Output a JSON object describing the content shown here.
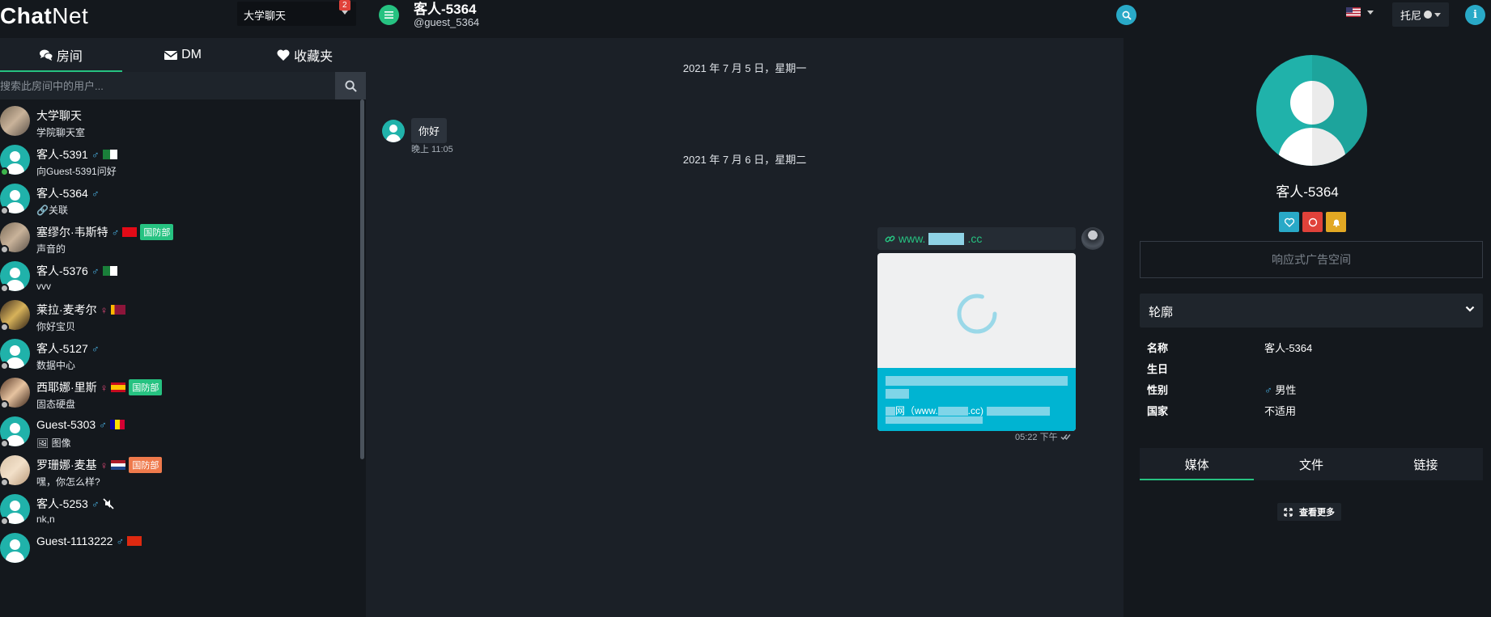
{
  "app": {
    "logo_bold": "Chat",
    "logo_light": "Net"
  },
  "room_select": {
    "value": "大学聊天",
    "badge": "2"
  },
  "sidebar_tabs": [
    {
      "label": "房间",
      "icon": "comments-icon",
      "active": true
    },
    {
      "label": "DM",
      "icon": "envelope-icon",
      "active": false
    },
    {
      "label": "收藏夹",
      "icon": "heart-icon",
      "active": false
    }
  ],
  "user_search": {
    "placeholder": "搜索此房间中的用户..."
  },
  "users": [
    {
      "name": "大学聊天",
      "message": "学院聊天室",
      "avatar": "photo",
      "status": "none"
    },
    {
      "name": "客人-5391",
      "gender": "♂",
      "flag": "algeria",
      "message": "向Guest-5391问好",
      "avatar": "default",
      "status": "online"
    },
    {
      "name": "客人-5364",
      "gender": "♂",
      "message": "🔗关联",
      "avatar": "default",
      "status": "away"
    },
    {
      "name": "塞缪尔·韦斯特",
      "gender": "♂",
      "flag": "turkey",
      "badge": "国防部",
      "badge_color": "#26c281",
      "message": "声音的",
      "avatar": "photo",
      "status": "away"
    },
    {
      "name": "客人-5376",
      "gender": "♂",
      "flag": "algeria",
      "message": "vvv",
      "avatar": "default",
      "status": "away"
    },
    {
      "name": "莱拉·麦考尔",
      "gender": "♀",
      "flag": "sri-lanka",
      "message": "你好宝贝",
      "avatar": "photo",
      "status": "away"
    },
    {
      "name": "客人-5127",
      "gender": "♂",
      "message": "数据中心",
      "avatar": "default",
      "status": "away"
    },
    {
      "name": "西耶娜·里斯",
      "gender": "♀",
      "flag": "spain",
      "badge": "国防部",
      "badge_color": "#26c281",
      "message": "固态硬盘",
      "avatar": "photo",
      "status": "away"
    },
    {
      "name": "Guest-5303",
      "gender": "♂",
      "flag": "andorra",
      "message": "🖼 图像",
      "avatar": "default",
      "status": "away"
    },
    {
      "name": "罗珊娜·麦基",
      "gender": "♀",
      "flag": "netherlands",
      "badge": "国防部",
      "badge_color": "#ef7a4c",
      "message": "嘿，你怎么样?",
      "avatar": "photo",
      "status": "away"
    },
    {
      "name": "客人-5253",
      "gender": "♂",
      "extra_icon": "muted-icon",
      "message": "nk,n",
      "avatar": "default",
      "status": "away"
    },
    {
      "name": "Guest-1113222",
      "gender": "♂",
      "flag": "china",
      "message": "",
      "avatar": "default",
      "status": "away"
    }
  ],
  "topbar": {
    "title": "客人-5364",
    "handle": "@guest_5364",
    "user_menu": "托尼",
    "lang_flag": "us"
  },
  "chat": {
    "date1": "2021 年 7 月 5 日，星期一",
    "msg1_text": "你好",
    "msg1_time": "晚上 11:05",
    "date2": "2021 年 7 月 6 日，星期二",
    "link_prefix": "www.",
    "link_suffix": ".cc",
    "link_desc": "网（www.",
    "link_desc_end": ".cc)",
    "msg2_time": "05:22 下午"
  },
  "profile": {
    "name": "客人-5364",
    "ad_text": "响应式广告空间",
    "outline_label": "轮廓",
    "fields": [
      {
        "label": "名称",
        "value": "客人-5364"
      },
      {
        "label": "生日",
        "value": ""
      },
      {
        "label": "性别",
        "value": "男性"
      },
      {
        "label": "国家",
        "value": "不适用"
      }
    ],
    "gender_symbol": "♂",
    "media_tabs": [
      "媒体",
      "文件",
      "链接"
    ],
    "see_more": "查看更多"
  },
  "colors": {
    "accent_green": "#26c281",
    "accent_blue": "#29a9c7",
    "avatar_teal": "#20b2aa",
    "link_card": "#00b4d2"
  }
}
